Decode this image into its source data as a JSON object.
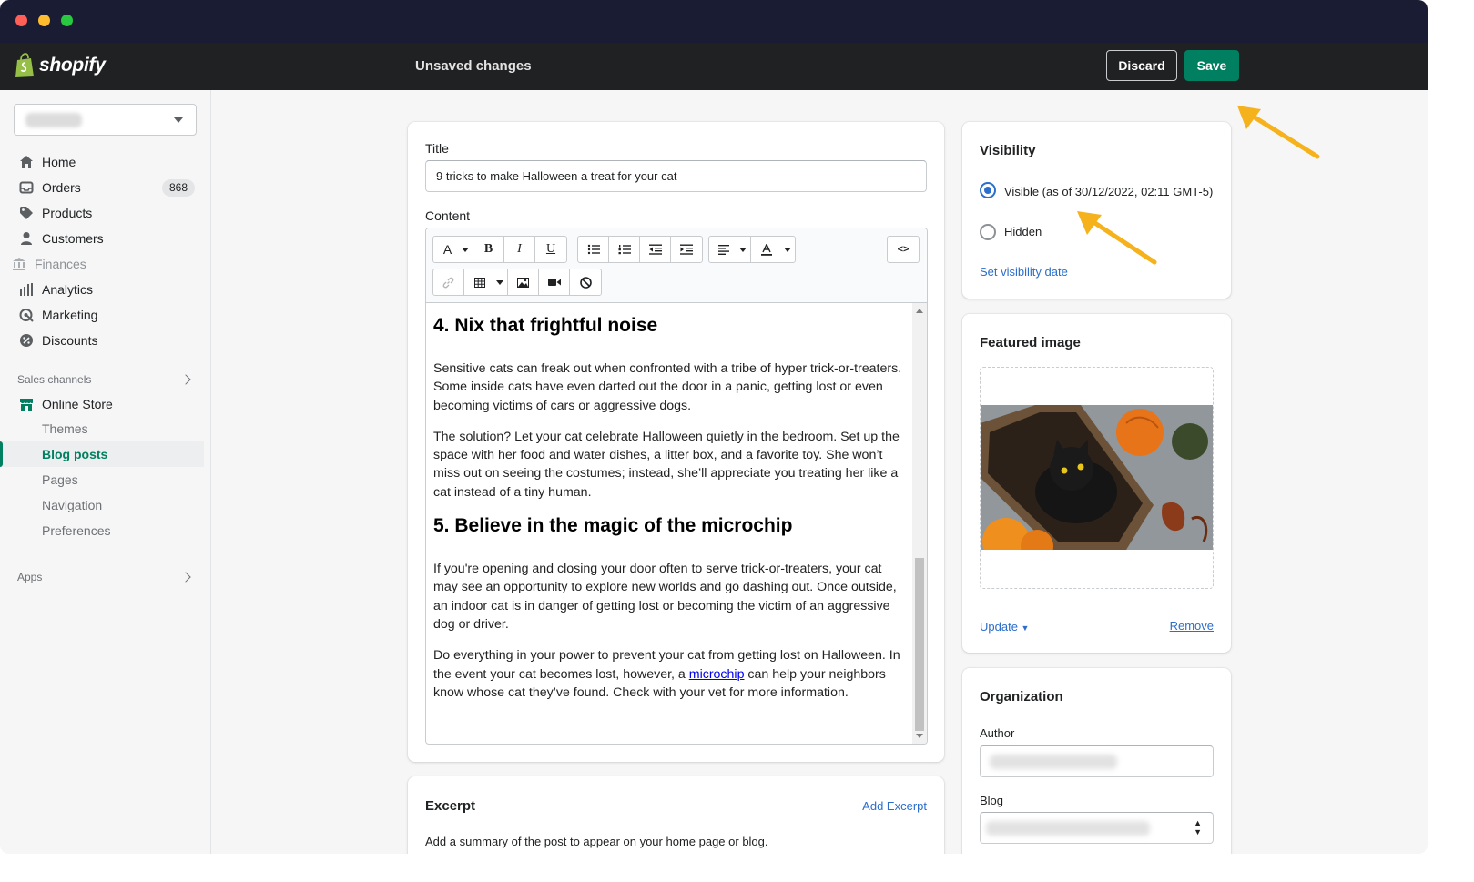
{
  "app": {
    "brand": "shopify",
    "status_title": "Unsaved changes"
  },
  "topbar": {
    "discard_label": "Discard",
    "save_label": "Save"
  },
  "sidebar": {
    "items": [
      {
        "label": "Home",
        "icon": "home-icon"
      },
      {
        "label": "Orders",
        "icon": "orders-icon",
        "badge": "868"
      },
      {
        "label": "Products",
        "icon": "tag-icon"
      },
      {
        "label": "Customers",
        "icon": "person-icon"
      },
      {
        "label": "Finances",
        "icon": "bank-icon",
        "disabled": true
      },
      {
        "label": "Analytics",
        "icon": "bar-chart-icon"
      },
      {
        "label": "Marketing",
        "icon": "target-icon"
      },
      {
        "label": "Discounts",
        "icon": "discount-icon"
      }
    ],
    "sales_channels_heading": "Sales channels",
    "online_store": "Online Store",
    "sub_items": [
      "Themes",
      "Blog posts",
      "Pages",
      "Navigation",
      "Preferences"
    ],
    "apps_heading": "Apps"
  },
  "post": {
    "title_label": "Title",
    "title_value": "9 tricks to make Halloween a treat for your cat",
    "content_label": "Content",
    "toolbar": {
      "row1": [
        "A",
        "B",
        "I",
        "U"
      ],
      "html_toggle": "<>"
    },
    "content": {
      "h4": "4. Nix that frightful noise",
      "p1": "Sensitive cats can freak out when confronted with a tribe of hyper trick-or-treaters. Some inside cats have even darted out the door in a panic, getting lost or even becoming victims of cars or aggressive dogs.",
      "p2": "The solution? Let your cat celebrate Halloween quietly in the bedroom. Set up the space with her food and water dishes, a litter box, and a favorite toy. She won’t miss out on seeing the costumes; instead, she’ll appreciate you treating her like a cat instead of a tiny human.",
      "h5": "5. Believe in the magic of the microchip",
      "p3": "If you're opening and closing your door often to serve trick-or-treaters, your cat may see an opportunity to explore new worlds and go dashing out. Once outside, an indoor cat is in danger of getting lost or becoming the victim of an aggressive dog or driver.",
      "p4_before": "Do everything in your power to prevent your cat from getting lost on Halloween. In the event your cat becomes lost, however, a ",
      "p4_link": "microchip",
      "p4_after": " can help your neighbors know whose cat they’ve found. Check with your vet for more information."
    }
  },
  "excerpt": {
    "heading": "Excerpt",
    "add_link": "Add Excerpt",
    "help": "Add a summary of the post to appear on your home page or blog."
  },
  "visibility": {
    "heading": "Visibility",
    "visible_label": "Visible (as of 30/12/2022, 02:11 GMT-5)",
    "hidden_label": "Hidden",
    "set_date_link": "Set visibility date",
    "selected": "visible"
  },
  "featured_image": {
    "heading": "Featured image",
    "update_link": "Update",
    "remove_link": "Remove"
  },
  "organization": {
    "heading": "Organization",
    "author_label": "Author",
    "blog_label": "Blog"
  },
  "colors": {
    "accent": "#008060",
    "link": "#2c6ecb",
    "topbar": "#202123",
    "annotation_arrow": "#f5b21c"
  }
}
